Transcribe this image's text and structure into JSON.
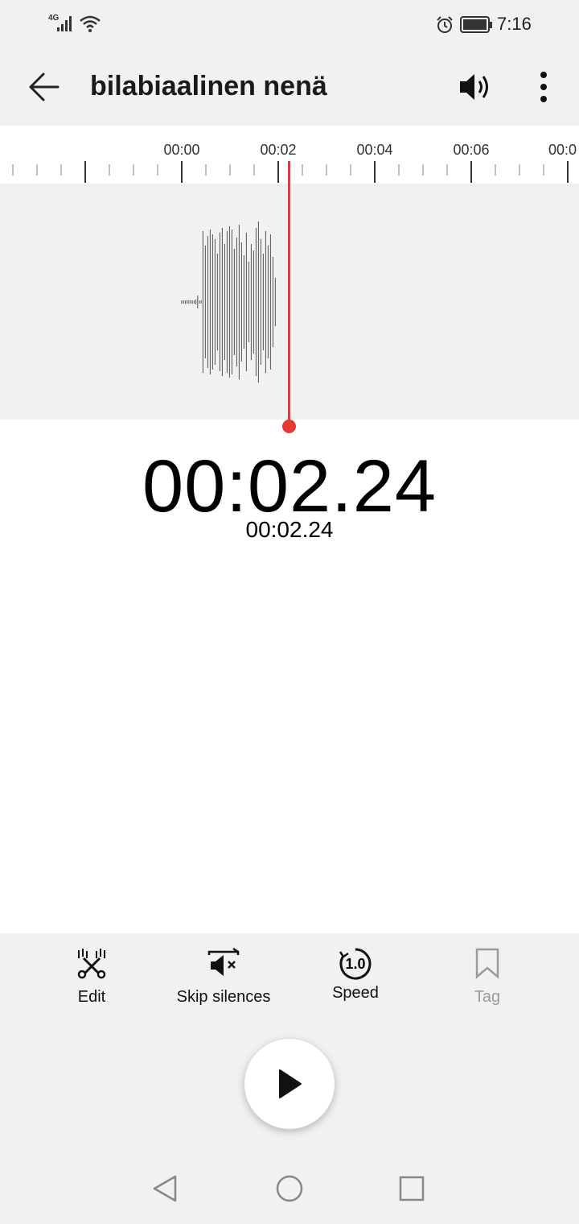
{
  "status_bar": {
    "network": "4G",
    "time": "7:16"
  },
  "app_bar": {
    "title": "bilabiaalinen nenä"
  },
  "timeline": {
    "labels": [
      "00:00",
      "00:02",
      "00:04",
      "00:06",
      "00:0"
    ]
  },
  "playback": {
    "position_large": "00:02.24",
    "position_small": "00:02.24"
  },
  "actions": {
    "edit": "Edit",
    "skip_silences": "Skip silences",
    "speed": "Speed",
    "speed_value": "1.0",
    "tag": "Tag"
  },
  "colors": {
    "playhead": "#e53935",
    "disabled": "#9b9b9b"
  }
}
